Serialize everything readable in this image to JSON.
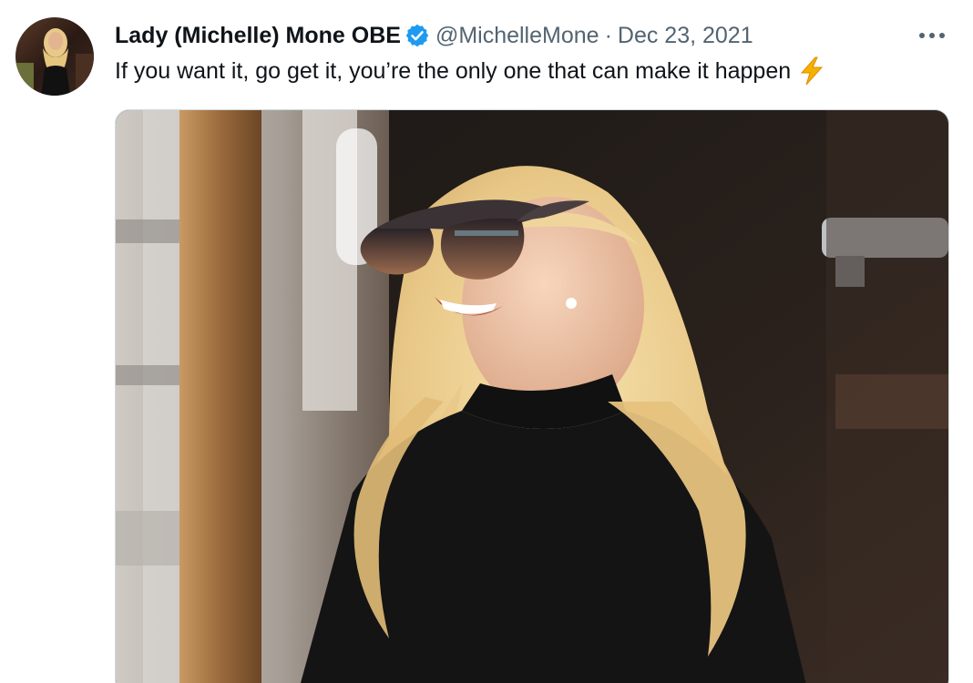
{
  "tweet": {
    "author": {
      "display_name": "Lady (Michelle) Mone OBE",
      "handle": "@MichelleMone",
      "verified_icon": "verified-badge-icon"
    },
    "separator": "·",
    "date": "Dec 23, 2021",
    "text": "If you want it, go get it, you’re the only one that can make it happen",
    "emoji": "high-voltage-icon",
    "more_icon": "more-horizontal-icon",
    "colors": {
      "verified": "#1d9bf0",
      "secondary_text": "#536471",
      "bolt": "#f6b100"
    }
  }
}
